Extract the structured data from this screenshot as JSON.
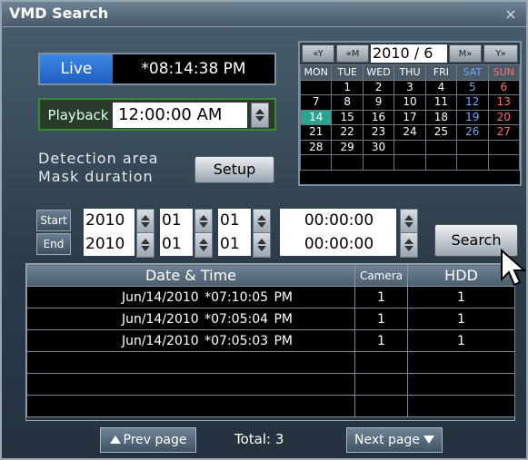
{
  "window": {
    "title": "VMD Search",
    "close_label": "×"
  },
  "live": {
    "label": "Live",
    "time": "*08:14:38 PM"
  },
  "playback": {
    "label": "Playback",
    "time": "12:00:00 AM"
  },
  "detection": {
    "line1": "Detection area",
    "line2": "Mask duration",
    "setup_label": "Setup"
  },
  "calendar": {
    "prev_year": "«Y",
    "prev_month": "«M",
    "year_month": "2010 /  6",
    "next_month": "M»",
    "next_year": "Y»",
    "day_headers": [
      "MON",
      "TUE",
      "WED",
      "THU",
      "FRI",
      "SAT",
      "SUN"
    ],
    "weeks": [
      [
        "",
        "1",
        "2",
        "3",
        "4",
        "5",
        "6"
      ],
      [
        "7",
        "8",
        "9",
        "10",
        "11",
        "12",
        "13"
      ],
      [
        "14",
        "15",
        "16",
        "17",
        "18",
        "19",
        "20"
      ],
      [
        "21",
        "22",
        "23",
        "24",
        "25",
        "26",
        "27"
      ],
      [
        "28",
        "29",
        "30",
        "",
        "",
        "",
        ""
      ],
      [
        "",
        "",
        "",
        "",
        "",
        "",
        ""
      ]
    ],
    "today": "14"
  },
  "range": {
    "start": {
      "label": "Start",
      "year": "2010",
      "month": "01",
      "day": "01",
      "time": "00:00:00"
    },
    "end": {
      "label": "End",
      "year": "2010",
      "month": "01",
      "day": "01",
      "time": "00:00:00"
    }
  },
  "search_label": "Search",
  "results": {
    "headers": {
      "datetime": "Date & Time",
      "camera": "Camera",
      "hdd": "HDD"
    },
    "rows": [
      {
        "datetime": "Jun/14/2010    *07:10:05 PM",
        "camera": "1",
        "hdd": "1"
      },
      {
        "datetime": "Jun/14/2010    *07:05:04 PM",
        "camera": "1",
        "hdd": "1"
      },
      {
        "datetime": "Jun/14/2010    *07:05:03 PM",
        "camera": "1",
        "hdd": "1"
      },
      {
        "datetime": "",
        "camera": "",
        "hdd": ""
      },
      {
        "datetime": "",
        "camera": "",
        "hdd": ""
      },
      {
        "datetime": "",
        "camera": "",
        "hdd": ""
      }
    ]
  },
  "pager": {
    "prev_label": "Prev page",
    "total": "Total: 3",
    "next_label": "Next page"
  },
  "colors": {
    "live_blue": "#1e5fc0",
    "today_teal": "#2aa38f",
    "saturday": "#6fa8ff",
    "sunday": "#ff7070"
  }
}
